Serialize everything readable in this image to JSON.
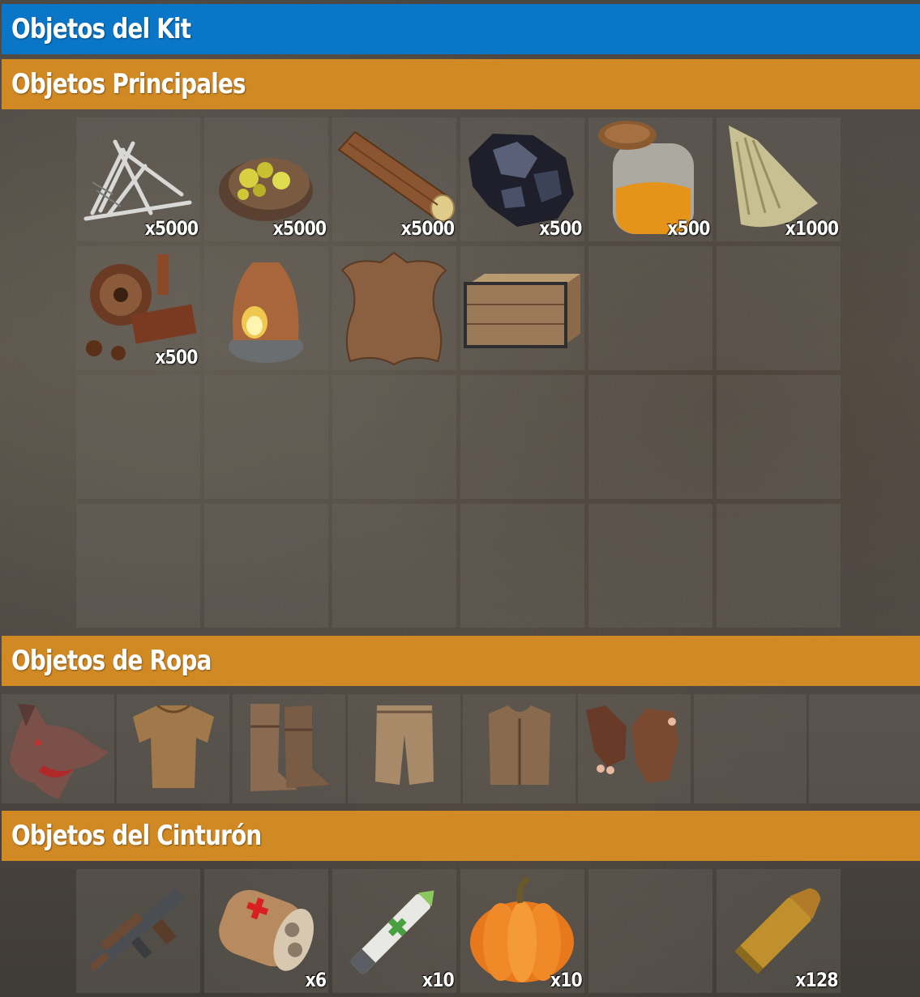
{
  "kit": {
    "title": "Objetos del Kit"
  },
  "sections": {
    "main": {
      "title": "Objetos Principales",
      "items": [
        {
          "icon": "wood-stakes-icon",
          "qty": "x5000"
        },
        {
          "icon": "sulfur-ore-icon",
          "qty": "x5000"
        },
        {
          "icon": "wood-log-icon",
          "qty": "x5000"
        },
        {
          "icon": "metal-ore-icon",
          "qty": "x500"
        },
        {
          "icon": "fuel-jar-icon",
          "qty": "x500"
        },
        {
          "icon": "cloth-icon",
          "qty": "x1000"
        },
        {
          "icon": "scrap-gears-icon",
          "qty": "x500"
        },
        {
          "icon": "furnace-icon",
          "qty": ""
        },
        {
          "icon": "leather-hide-icon",
          "qty": ""
        },
        {
          "icon": "wooden-box-icon",
          "qty": ""
        }
      ]
    },
    "clothing": {
      "title": "Objetos de Ropa",
      "items": [
        {
          "icon": "wolf-headdress-icon"
        },
        {
          "icon": "burlap-shirt-icon"
        },
        {
          "icon": "burlap-boots-icon"
        },
        {
          "icon": "burlap-trousers-icon"
        },
        {
          "icon": "leather-vest-icon"
        },
        {
          "icon": "leather-gloves-icon"
        }
      ]
    },
    "belt": {
      "title": "Objetos del Cinturón",
      "items": [
        {
          "icon": "thompson-smg-icon",
          "qty": ""
        },
        {
          "icon": "medical-bandage-icon",
          "qty": "x6"
        },
        {
          "icon": "medical-syringe-icon",
          "qty": "x10"
        },
        {
          "icon": "pumpkin-icon",
          "qty": "x10"
        },
        {
          "icon": "empty-slot",
          "qty": ""
        },
        {
          "icon": "pistol-bullet-icon",
          "qty": "x128"
        }
      ]
    }
  },
  "colors": {
    "kit_header": "#0a76c8",
    "section_header": "#d18a23"
  }
}
